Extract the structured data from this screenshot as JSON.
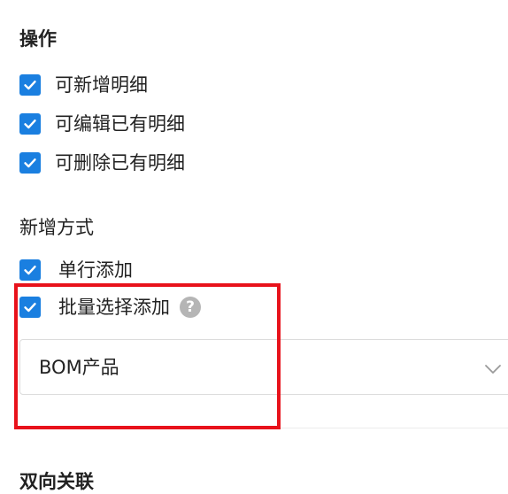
{
  "operations": {
    "title": "操作",
    "items": [
      {
        "label": "可新增明细",
        "checked": true
      },
      {
        "label": "可编辑已有明细",
        "checked": true
      },
      {
        "label": "可删除已有明细",
        "checked": true
      }
    ]
  },
  "add_mode": {
    "title": "新增方式",
    "items": [
      {
        "label": "单行添加",
        "checked": true
      },
      {
        "label": "批量选择添加",
        "checked": true
      }
    ],
    "help_icon": "question-circle-icon",
    "help_glyph": "?"
  },
  "batch_source_select": {
    "value": "BOM产品",
    "icon": "chevron-down-icon"
  },
  "next_section": {
    "title": "双向关联"
  },
  "colors": {
    "checkbox": "#1a7fe0",
    "highlight": "#e8121b"
  }
}
